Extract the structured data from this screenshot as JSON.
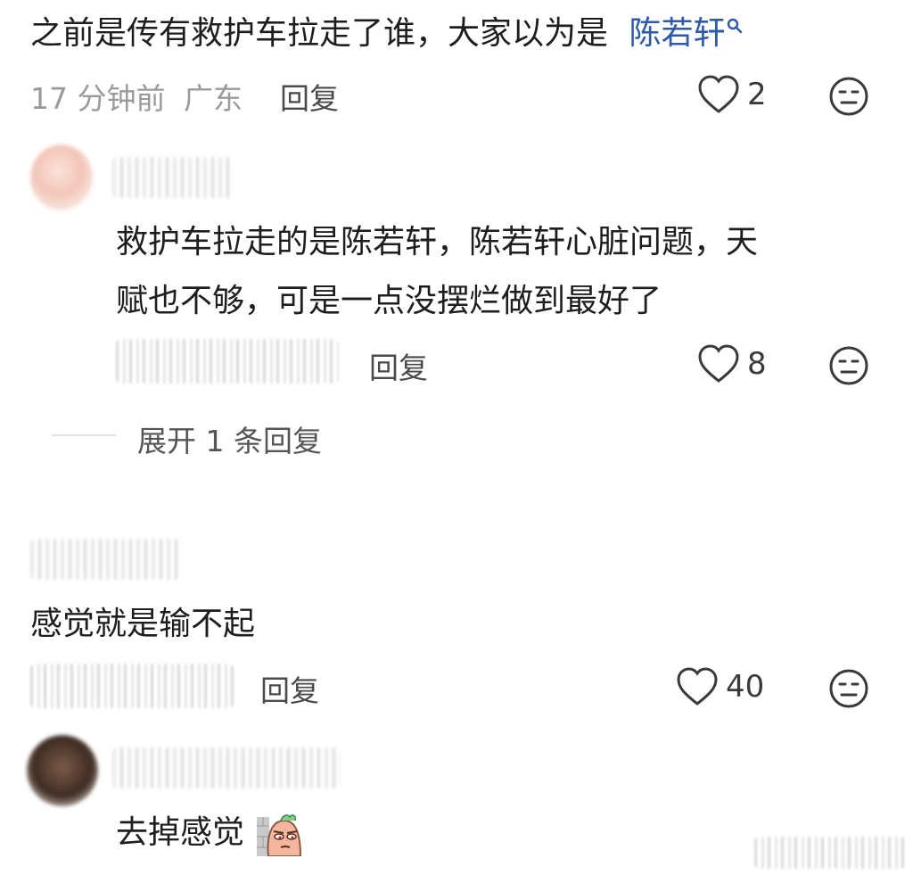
{
  "comments": [
    {
      "text": "之前是传有救护车拉走了谁，大家以为是",
      "link_text": "陈若轩",
      "time": "17 分钟前",
      "location": "广东",
      "reply_label": "回复",
      "likes": "2"
    },
    {
      "text_line1": "救护车拉走的是陈若轩，陈若轩心脏问题，天",
      "text_line2": "赋也不够，可是一点没摆烂做到最好了",
      "reply_label": "回复",
      "likes": "8",
      "expand_label": "展开 1 条回复"
    },
    {
      "text": "感觉就是输不起",
      "reply_label": "回复",
      "likes": "40"
    },
    {
      "text": "去掉感觉"
    }
  ],
  "icons": {
    "search": "search-icon",
    "like": "heart-icon",
    "dislike": "meh-face-icon",
    "emoji": "sticker-emoji-icon"
  },
  "colors": {
    "link": "#2f5aa8",
    "meta": "#9a9a9a",
    "icon": "#3a3a3a"
  }
}
